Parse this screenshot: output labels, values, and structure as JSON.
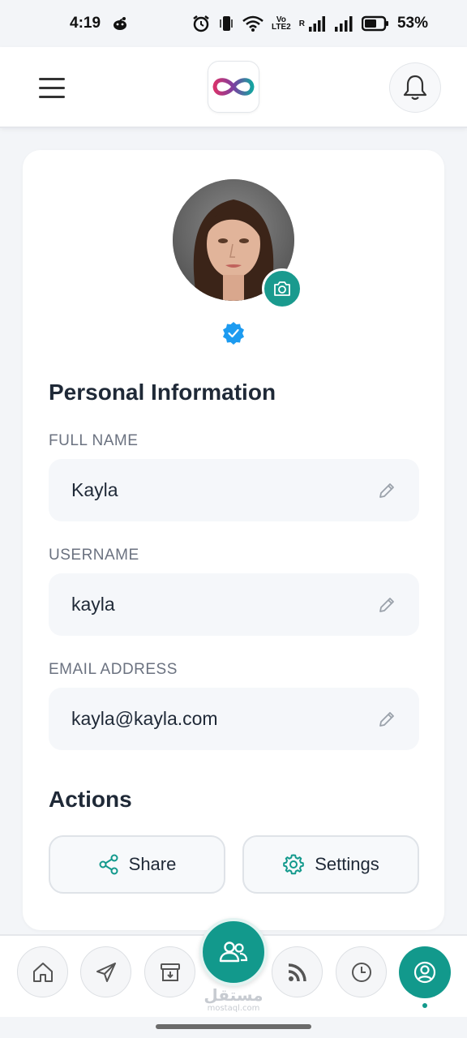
{
  "status_bar": {
    "time": "4:19",
    "volte": "Vo\nLTE2",
    "roaming": "R",
    "battery": "53%"
  },
  "header": {
    "menu_icon": "hamburger-menu-icon",
    "logo_icon": "infinity-logo-icon",
    "notification_icon": "bell-icon"
  },
  "profile": {
    "camera_icon": "camera-icon",
    "verified_icon": "verified-badge-icon"
  },
  "personal_info": {
    "title": "Personal Information",
    "full_name": {
      "label": "FULL NAME",
      "value": "Kayla"
    },
    "username": {
      "label": "USERNAME",
      "value": "kayla"
    },
    "email": {
      "label": "EMAIL ADDRESS",
      "value": "kayla@kayla.com"
    }
  },
  "actions": {
    "title": "Actions",
    "share_label": "Share",
    "settings_label": "Settings"
  },
  "bottom_nav": {
    "items": [
      "home-icon",
      "send-icon",
      "archive-icon",
      "group-icon",
      "rss-icon",
      "history-icon",
      "profile-icon"
    ],
    "active": "profile"
  },
  "watermark": {
    "main": "مستقل",
    "sub": "mostaql.com"
  },
  "colors": {
    "accent": "#12998c",
    "verified": "#1d9bf0",
    "background": "#f3f5f8"
  }
}
